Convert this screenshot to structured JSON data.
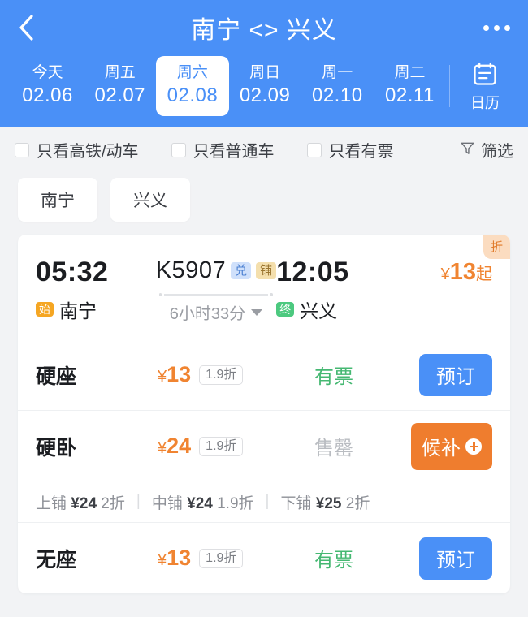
{
  "header": {
    "title": "南宁 <> 兴义",
    "back_icon": "chevron-left-icon",
    "more_icon": "more-dots-icon",
    "calendar": {
      "icon": "calendar-icon",
      "label": "日历"
    },
    "dates": [
      {
        "dow": "今天",
        "date": "02.06",
        "active": false
      },
      {
        "dow": "周五",
        "date": "02.07",
        "active": false
      },
      {
        "dow": "周六",
        "date": "02.08",
        "active": true
      },
      {
        "dow": "周日",
        "date": "02.09",
        "active": false
      },
      {
        "dow": "周一",
        "date": "02.10",
        "active": false
      },
      {
        "dow": "周二",
        "date": "02.11",
        "active": false
      }
    ]
  },
  "filters": {
    "checkboxes": [
      {
        "label": "只看高铁/动车",
        "checked": false
      },
      {
        "label": "只看普通车",
        "checked": false
      },
      {
        "label": "只看有票",
        "checked": false
      }
    ],
    "filter_button": {
      "label": "筛选",
      "icon": "funnel-icon"
    },
    "station_chips": [
      "南宁",
      "兴义"
    ]
  },
  "train": {
    "corner_tag": "折",
    "depart": {
      "time": "05:32",
      "badge": "始",
      "station": "南宁"
    },
    "arrive": {
      "time": "12:05",
      "badge": "终",
      "station": "兴义"
    },
    "number": "K5907",
    "badges": [
      {
        "text": "兑",
        "kind": "exchange"
      },
      {
        "text": "铺",
        "kind": "berth"
      }
    ],
    "duration": "6小时33分",
    "duration_caret": "chevron-down-icon",
    "price_prefix": "¥",
    "price_value": "13",
    "price_suffix": "起",
    "seats": [
      {
        "name": "硬座",
        "currency": "¥",
        "price": "13",
        "discount": "1.9折",
        "status": "有票",
        "status_kind": "ok",
        "action": "预订",
        "action_kind": "book"
      },
      {
        "name": "硬卧",
        "currency": "¥",
        "price": "24",
        "discount": "1.9折",
        "status": "售罄",
        "status_kind": "soldout",
        "action": "候补",
        "action_kind": "waitlist",
        "berths": [
          {
            "label": "上铺",
            "currency": "¥",
            "price": "24",
            "discount": "2折"
          },
          {
            "label": "中铺",
            "currency": "¥",
            "price": "24",
            "discount": "1.9折"
          },
          {
            "label": "下铺",
            "currency": "¥",
            "price": "25",
            "discount": "2折"
          }
        ]
      },
      {
        "name": "无座",
        "currency": "¥",
        "price": "13",
        "discount": "1.9折",
        "status": "有票",
        "status_kind": "ok",
        "action": "预订",
        "action_kind": "book"
      }
    ]
  },
  "colors": {
    "brand_blue": "#4a90f7",
    "orange": "#f08431",
    "waitlist_orange": "#ef7d2e",
    "green": "#45b872",
    "page_bg": "#f2f3f5"
  }
}
